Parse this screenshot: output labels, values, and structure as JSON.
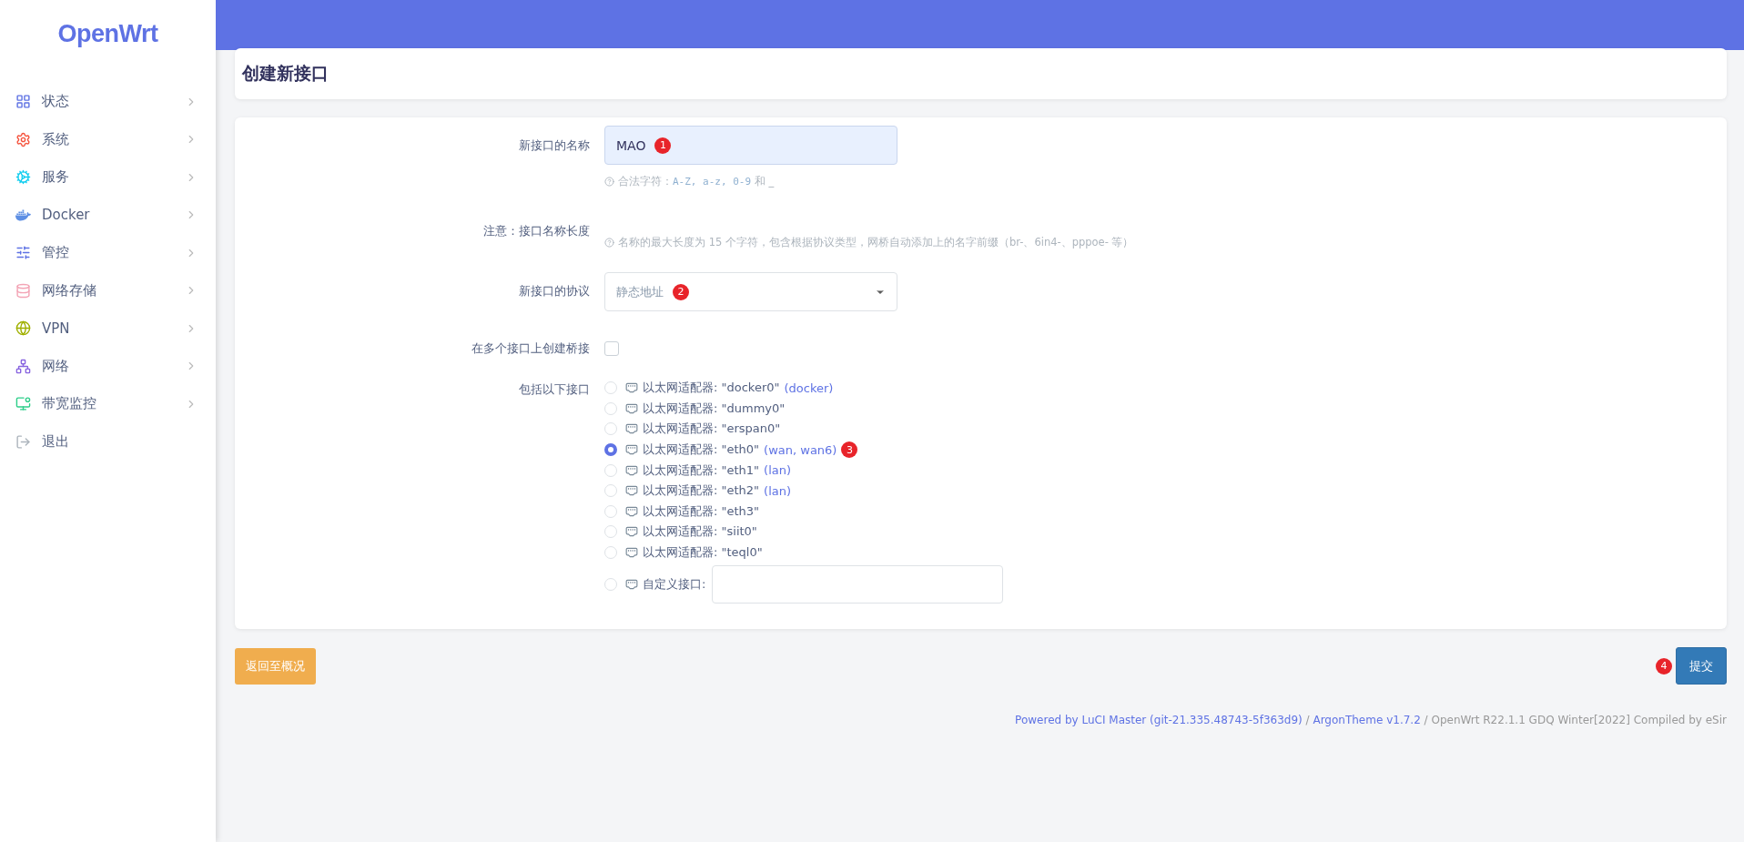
{
  "sidebar": {
    "logo": "OpenWrt",
    "items": [
      {
        "label": "状态",
        "kind": "status",
        "submenu": true
      },
      {
        "label": "系统",
        "kind": "system",
        "submenu": true
      },
      {
        "label": "服务",
        "kind": "services",
        "submenu": true
      },
      {
        "label": "Docker",
        "kind": "docker",
        "submenu": true
      },
      {
        "label": "管控",
        "kind": "control",
        "submenu": true
      },
      {
        "label": "网络存储",
        "kind": "storage",
        "submenu": true
      },
      {
        "label": "VPN",
        "kind": "vpn",
        "submenu": true
      },
      {
        "label": "网络",
        "kind": "network",
        "submenu": true
      },
      {
        "label": "带宽监控",
        "kind": "bandwidth",
        "submenu": true
      },
      {
        "label": "退出",
        "kind": "logout",
        "submenu": false
      }
    ]
  },
  "page_title": "创建新接口",
  "form": {
    "rows": [
      {
        "kind": "text",
        "label": "新接口的名称",
        "value": "MAO",
        "badge": "1",
        "hint": "合法字符：",
        "hint_code": "A-Z, a-z, 0-9",
        "hint_end": " 和 _"
      },
      {
        "kind": "note",
        "label": "注意：接口名称长度",
        "hint": "名称的最大长度为 15 个字符，包含根据协议类型，网桥自动添加上的名字前缀（br-、6in4-、pppoe- 等）"
      },
      {
        "kind": "select",
        "label": "新接口的协议",
        "value": "静态地址",
        "badge": "2"
      },
      {
        "kind": "checkbox",
        "label": "在多个接口上创建桥接",
        "checked": false
      },
      {
        "kind": "radios",
        "label": "包括以下接口",
        "options": [
          {
            "label": "以太网适配器: \"docker0\"",
            "networks": "(docker)",
            "selected": false
          },
          {
            "label": "以太网适配器: \"dummy0\"",
            "selected": false
          },
          {
            "label": "以太网适配器: \"erspan0\"",
            "selected": false
          },
          {
            "label": "以太网适配器: \"eth0\"",
            "networks": "(wan, wan6)",
            "selected": true,
            "badge": "3"
          },
          {
            "label": "以太网适配器: \"eth1\"",
            "networks": "(lan)",
            "selected": false
          },
          {
            "label": "以太网适配器: \"eth2\"",
            "networks": "(lan)",
            "selected": false
          },
          {
            "label": "以太网适配器: \"eth3\"",
            "selected": false
          },
          {
            "label": "以太网适配器: \"siit0\"",
            "selected": false
          },
          {
            "label": "以太网适配器: \"teql0\"",
            "selected": false
          }
        ],
        "custom": {
          "label": "自定义接口:",
          "selected": false
        }
      }
    ]
  },
  "actions": {
    "back": "返回至概况",
    "submit": "提交",
    "submit_badge": "4"
  },
  "footer": {
    "luci": "Powered by LuCI Master (git-21.335.48743-5f363d9)",
    "sep": " / ",
    "theme": "ArgonTheme v1.7.2",
    "build": " / OpenWrt R22.1.1 GDQ Winter[2022] Compiled by eSir"
  }
}
